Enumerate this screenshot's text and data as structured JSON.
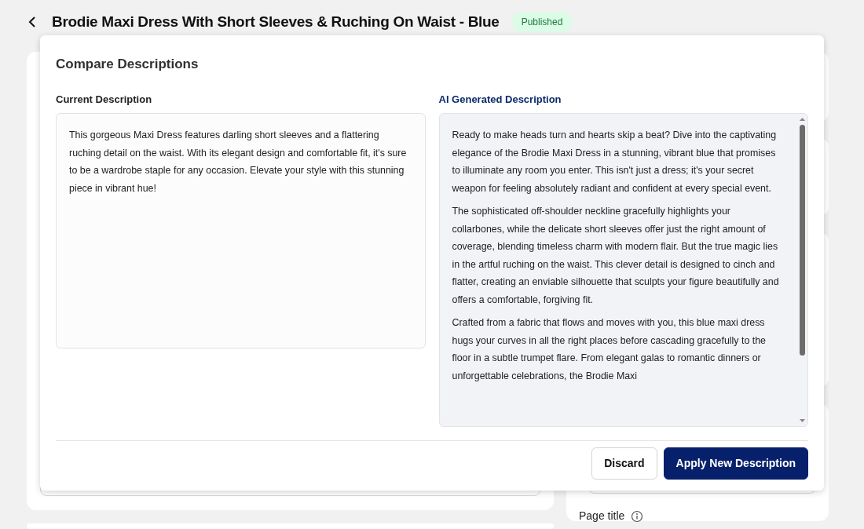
{
  "header": {
    "title": "Brodie Maxi Dress With Short Sleeves & Ruching On Waist - Blue",
    "status": "Published"
  },
  "side_panel": {
    "field_label": "Page title"
  },
  "modal": {
    "title": "Compare Descriptions",
    "current": {
      "label": "Current Description",
      "paragraphs": [
        "This gorgeous Maxi Dress features darling short sleeves and a flattering ruching detail on the waist. With its elegant design and comfortable fit, it's sure to be a wardrobe staple for any occasion. Elevate your style with this stunning piece in vibrant hue!"
      ]
    },
    "generated": {
      "label": "AI Generated Description",
      "paragraphs": [
        "Ready to make heads turn and hearts skip a beat? Dive into the captivating elegance of the Brodie Maxi Dress in a stunning, vibrant blue that promises to illuminate any room you enter. This isn't just a dress; it's your secret weapon for feeling absolutely radiant and confident at every special event.",
        "The sophisticated off-shoulder neckline gracefully highlights your collarbones, while the delicate short sleeves offer just the right amount of coverage, blending timeless charm with modern flair. But the true magic lies in the artful ruching on the waist. This clever detail is designed to cinch and flatter, creating an enviable silhouette that sculpts your figure beautifully and offers a comfortable, forgiving fit.",
        "Crafted from a fabric that flows and moves with you, this blue maxi dress hugs your curves in all the right places before cascading gracefully to the floor in a subtle trumpet flare. From elegant galas to romantic dinners or unforgettable celebrations, the Brodie Maxi"
      ]
    },
    "buttons": [
      {
        "label": "Discard",
        "kind": "secondary"
      },
      {
        "label": "Apply New Description",
        "kind": "primary"
      }
    ]
  }
}
